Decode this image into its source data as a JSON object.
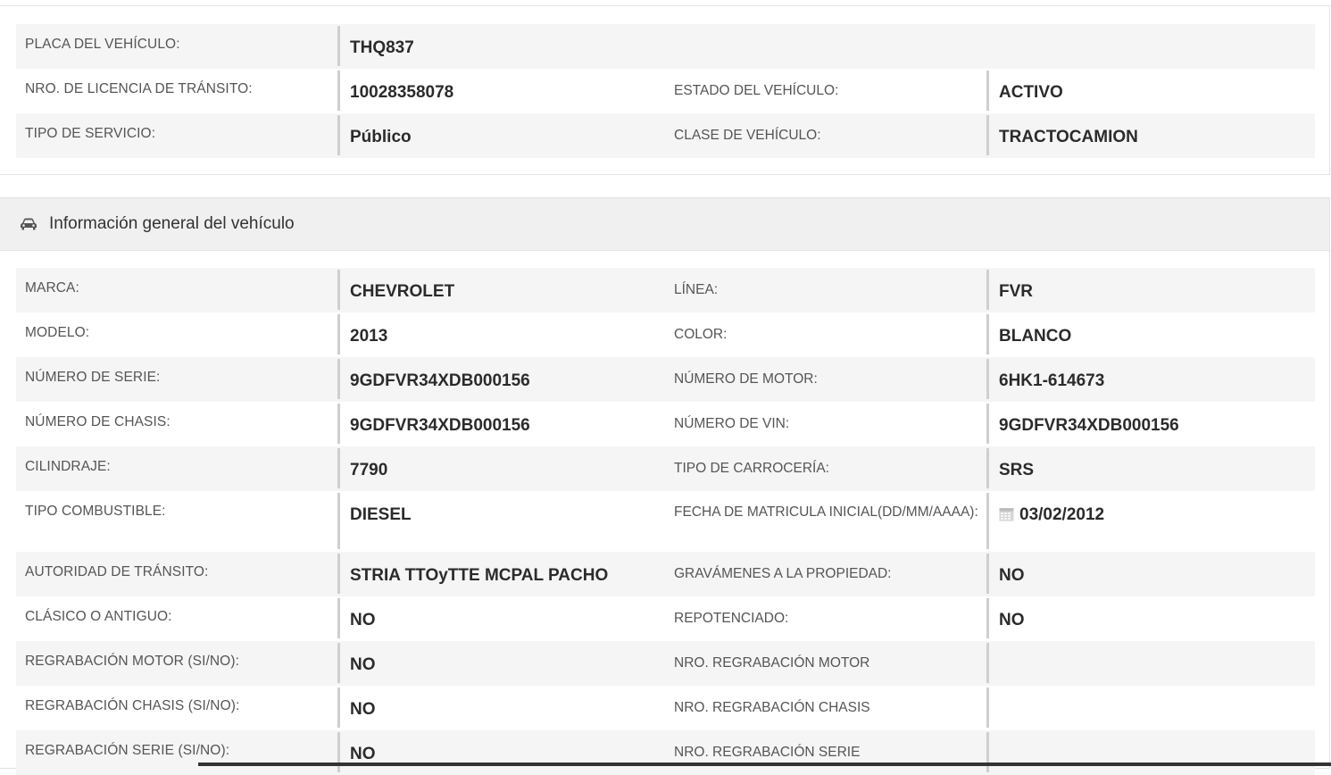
{
  "top": {
    "rows": [
      {
        "label": "PLACA DEL VEHÍCULO:",
        "value": "THQ837"
      },
      {
        "label": "NRO. DE LICENCIA DE TRÁNSITO:",
        "value": "10028358078",
        "label2": "ESTADO DEL VEHÍCULO:",
        "value2": "ACTIVO"
      },
      {
        "label": "TIPO DE SERVICIO:",
        "value": "Público",
        "label2": "CLASE DE VEHÍCULO:",
        "value2": "TRACTOCAMION"
      }
    ]
  },
  "general": {
    "title": "Información general del vehículo",
    "icon": "car-icon",
    "rows": [
      {
        "label": "MARCA:",
        "value": "CHEVROLET",
        "label2": "LÍNEA:",
        "value2": "FVR"
      },
      {
        "label": "MODELO:",
        "value": "2013",
        "label2": "COLOR:",
        "value2": "BLANCO"
      },
      {
        "label": "NÚMERO DE SERIE:",
        "value": "9GDFVR34XDB000156",
        "label2": "NÚMERO DE MOTOR:",
        "value2": "6HK1-614673"
      },
      {
        "label": "NÚMERO DE CHASIS:",
        "value": "9GDFVR34XDB000156",
        "label2": "NÚMERO DE VIN:",
        "value2": "9GDFVR34XDB000156"
      },
      {
        "label": "CILINDRAJE:",
        "value": "7790",
        "label2": "TIPO DE CARROCERÍA:",
        "value2": "SRS"
      },
      {
        "label": "TIPO COMBUSTIBLE:",
        "value": "DIESEL",
        "label2": "FECHA DE MATRICULA INICIAL(DD/MM/AAAA):",
        "value2": "03/02/2012"
      },
      {
        "label": "AUTORIDAD DE TRÁNSITO:",
        "value": "STRIA TTOyTTE MCPAL PACHO",
        "label2": "GRAVÁMENES A LA PROPIEDAD:",
        "value2": "NO"
      },
      {
        "label": "CLÁSICO O ANTIGUO:",
        "value": "NO",
        "label2": "REPOTENCIADO:",
        "value2": "NO"
      },
      {
        "label": "REGRABACIÓN MOTOR (SI/NO):",
        "value": "NO",
        "label2": "NRO. REGRABACIÓN MOTOR",
        "value2": ""
      },
      {
        "label": "REGRABACIÓN CHASIS (SI/NO):",
        "value": "NO",
        "label2": "NRO. REGRABACIÓN CHASIS",
        "value2": ""
      },
      {
        "label": "REGRABACIÓN SERIE (SI/NO):",
        "value": "NO",
        "label2": "NRO. REGRABACIÓN SERIE",
        "value2": ""
      }
    ]
  },
  "colors": {
    "label": "#555555",
    "value": "#2b2b2b",
    "stripe": "#f5f5f5",
    "header_bg": "#f0f0f0"
  }
}
